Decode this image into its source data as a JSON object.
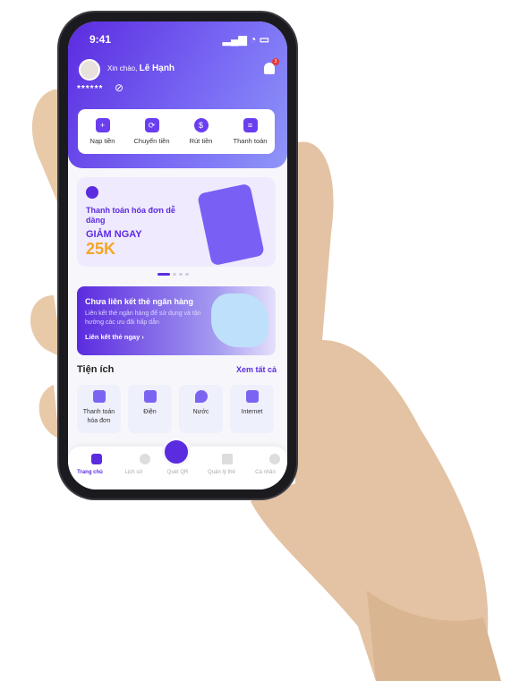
{
  "status": {
    "time": "9:41"
  },
  "header": {
    "greeting": "Xin chào,",
    "user_name": "Lê Hạnh",
    "balance_masked": "******",
    "notification_count": "3"
  },
  "quick_actions": [
    {
      "label": "Nạp tiền",
      "icon": "wallet-plus-icon"
    },
    {
      "label": "Chuyển tiền",
      "icon": "transfer-icon"
    },
    {
      "label": "Rút tiền",
      "icon": "withdraw-icon"
    },
    {
      "label": "Thanh toán",
      "icon": "scan-icon"
    }
  ],
  "promo_banner": {
    "title": "Thanh toán hóa đơn dễ dàng",
    "discount_label": "GIẢM NGAY",
    "discount_value": "25K",
    "active_slide": 1,
    "slide_count": 4
  },
  "link_card": {
    "title": "Chưa liên kết thẻ ngân hàng",
    "description": "Liên kết thẻ ngân hàng để sử dụng và tận hưởng các ưu đãi hấp dẫn",
    "cta": "Liên kết thẻ ngay"
  },
  "utilities": {
    "title": "Tiện ích",
    "see_all": "Xem tất cả",
    "items": [
      {
        "label": "Thanh toán hóa đơn"
      },
      {
        "label": "Điện"
      },
      {
        "label": "Nước"
      },
      {
        "label": "Internet"
      }
    ]
  },
  "bottom_nav": [
    {
      "label": "Trang chủ",
      "active": true
    },
    {
      "label": "Lịch sử"
    },
    {
      "label": "Quét QR"
    },
    {
      "label": "Quản lý thẻ"
    },
    {
      "label": "Cá nhân"
    }
  ],
  "colors": {
    "primary": "#5B2BE0",
    "accent": "#F5A623"
  }
}
